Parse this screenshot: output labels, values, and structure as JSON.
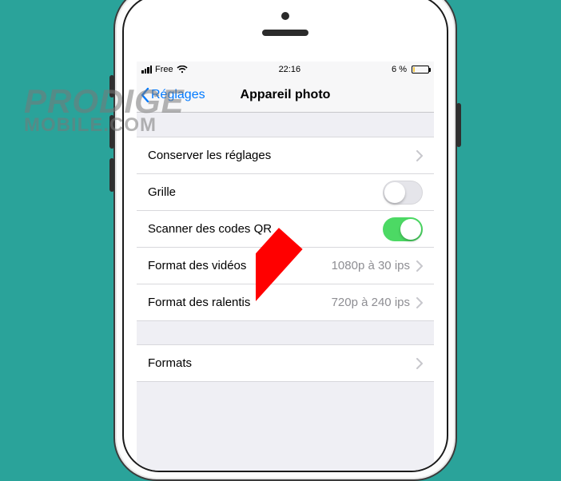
{
  "status": {
    "carrier": "Free",
    "time": "22:16",
    "battery_text": "6 %"
  },
  "nav": {
    "back_label": "Réglages",
    "title": "Appareil photo"
  },
  "rows": {
    "preserve": "Conserver les réglages",
    "grid": "Grille",
    "qr": "Scanner des codes QR",
    "video_format_label": "Format des vidéos",
    "video_format_value": "1080p à 30 ips",
    "slomo_label": "Format des ralentis",
    "slomo_value": "720p à 240 ips",
    "formats": "Formats"
  },
  "toggles": {
    "grid": false,
    "qr": true
  },
  "watermark": {
    "line1": "PRODIGE",
    "line2": "MOBILE.COM"
  }
}
